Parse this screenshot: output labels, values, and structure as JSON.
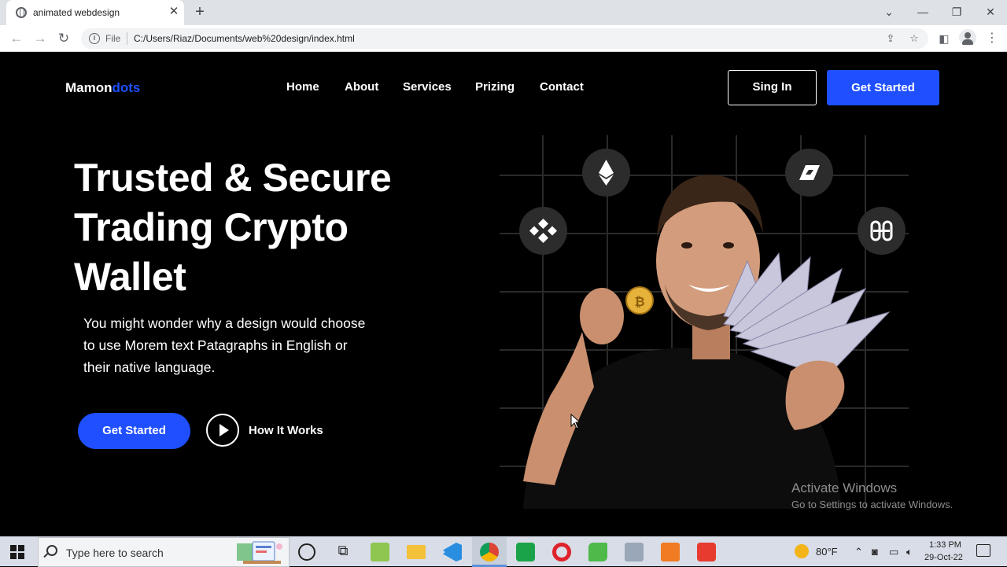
{
  "browser": {
    "tab_title": "animated webdesign",
    "tab_close": "✕",
    "new_tab": "+",
    "url_scheme": "File",
    "url": "C:/Users/Riaz/Documents/web%20design/index.html",
    "icons": [
      "globe-icon",
      "back-icon",
      "forward-icon",
      "reload-icon",
      "info-icon",
      "share-icon",
      "star-icon",
      "sidepanel-icon",
      "profile-icon",
      "menu-icon"
    ]
  },
  "site": {
    "logo_main": "Mamon",
    "logo_accent": "dots",
    "accent_color": "#1f4fff",
    "nav": [
      "Home",
      "About",
      "Services",
      "Prizing",
      "Contact"
    ],
    "signin_label": "Sing In",
    "header_cta_label": "Get Started",
    "hero": {
      "title_lines": [
        "Trusted & Secure",
        "Trading Crypto",
        "Wallet"
      ],
      "description_lines": [
        "You might wonder why a design would choose",
        "to use Morem text Patagraphs in English or",
        "their native language."
      ],
      "cta_label": "Get Started",
      "secondary_label": "How It Works"
    },
    "crypto_badges": [
      "ethereum-icon",
      "binance-icon",
      "gala-icon",
      "harmony-icon"
    ]
  },
  "watermark": {
    "line1": "Activate Windows",
    "line2": "Go to Settings to activate Windows."
  },
  "taskbar": {
    "search_placeholder": "Type here to search",
    "apps": [
      "task-view-icon",
      "notepadpp-icon",
      "file-explorer-icon",
      "vscode-icon",
      "chrome-icon",
      "camtasia-icon",
      "opera-icon",
      "evernote-icon",
      "network-monitor-icon",
      "xampp-icon",
      "camtasia-recorder-icon"
    ],
    "temperature": "80°F",
    "time": "1:33 PM",
    "date": "29-Oct-22"
  }
}
